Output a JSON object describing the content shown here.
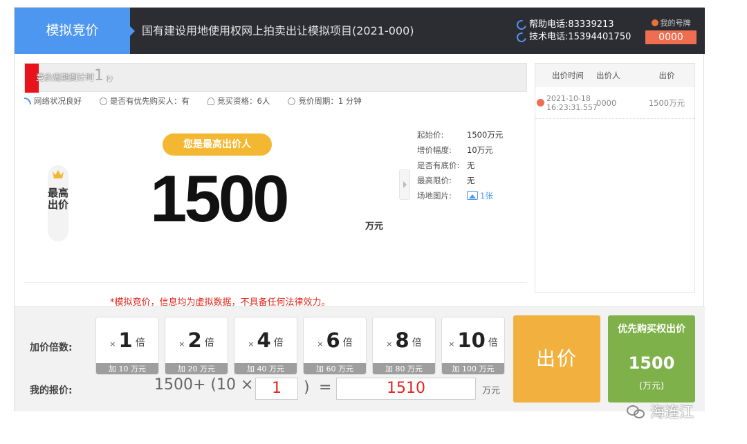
{
  "header": {
    "brand": "模拟竞价",
    "title": "国有建设用地使用权网上拍卖出让模拟项目(2021-000)",
    "help_phone": "帮助电话:83339213",
    "tech_phone": "技术电话:15394401750",
    "plate_label": "我的号牌",
    "plate_value": "0000"
  },
  "countdown": {
    "label": "竞价周期倒计时",
    "value": "1",
    "unit": "秒"
  },
  "status": {
    "network": "网络状况良好",
    "priority_buyer": "是否有优先购买人：有",
    "qualification": "竞买资格：6人",
    "cycle": "竞价周期：1 分钟"
  },
  "bid": {
    "side_tag": "最高出价",
    "badge": "您是最高出价人",
    "price": "1500",
    "unit": "万元"
  },
  "info": {
    "rows": [
      {
        "k": "起始价:",
        "v": "1500万元"
      },
      {
        "k": "增价幅度:",
        "v": "10万元"
      },
      {
        "k": "是否有底价:",
        "v": "无"
      },
      {
        "k": "最高限价:",
        "v": "无"
      }
    ],
    "image_label": "场地图片:",
    "image_count": "1张"
  },
  "disclaimer": "*模拟竞价，信息均为虚拟数据，不具备任何法律效力。",
  "history": {
    "headers": [
      "出价时间",
      "出价人",
      "出价"
    ],
    "rows": [
      {
        "date": "2021-10-18",
        "time": "16:23:31.557",
        "bidder": "0000",
        "price": "1500万元"
      }
    ]
  },
  "controls": {
    "mult_label": "加价倍数:",
    "mine_label": "我的报价:",
    "multipliers": [
      {
        "x": "×",
        "n": "1",
        "b": "倍",
        "foot": "加 10 万元"
      },
      {
        "x": "×",
        "n": "2",
        "b": "倍",
        "foot": "加 20 万元"
      },
      {
        "x": "×",
        "n": "4",
        "b": "倍",
        "foot": "加 40 万元"
      },
      {
        "x": "×",
        "n": "6",
        "b": "倍",
        "foot": "加 60 万元"
      },
      {
        "x": "×",
        "n": "8",
        "b": "倍",
        "foot": "加 80 万元"
      },
      {
        "x": "×",
        "n": "10",
        "b": "倍",
        "foot": "加 100 万元"
      }
    ],
    "formula_prefix": "1500+ (10 ×",
    "formula_input": "1",
    "formula_close": ")",
    "formula_eq": "=",
    "result": "1510",
    "result_unit": "万元",
    "bid_button": "出价",
    "pref_title": "优先购买权出价",
    "pref_value": "1500",
    "pref_unit": "(万元)"
  },
  "watermark": "海连江",
  "colors": {
    "header_bg": "#2b2d33",
    "brand_blue": "#4e97f0",
    "badge_orange": "#f4b731",
    "bid_orange": "#f2b13e",
    "pref_green": "#7fb14a",
    "alert_red": "#e1251b"
  }
}
